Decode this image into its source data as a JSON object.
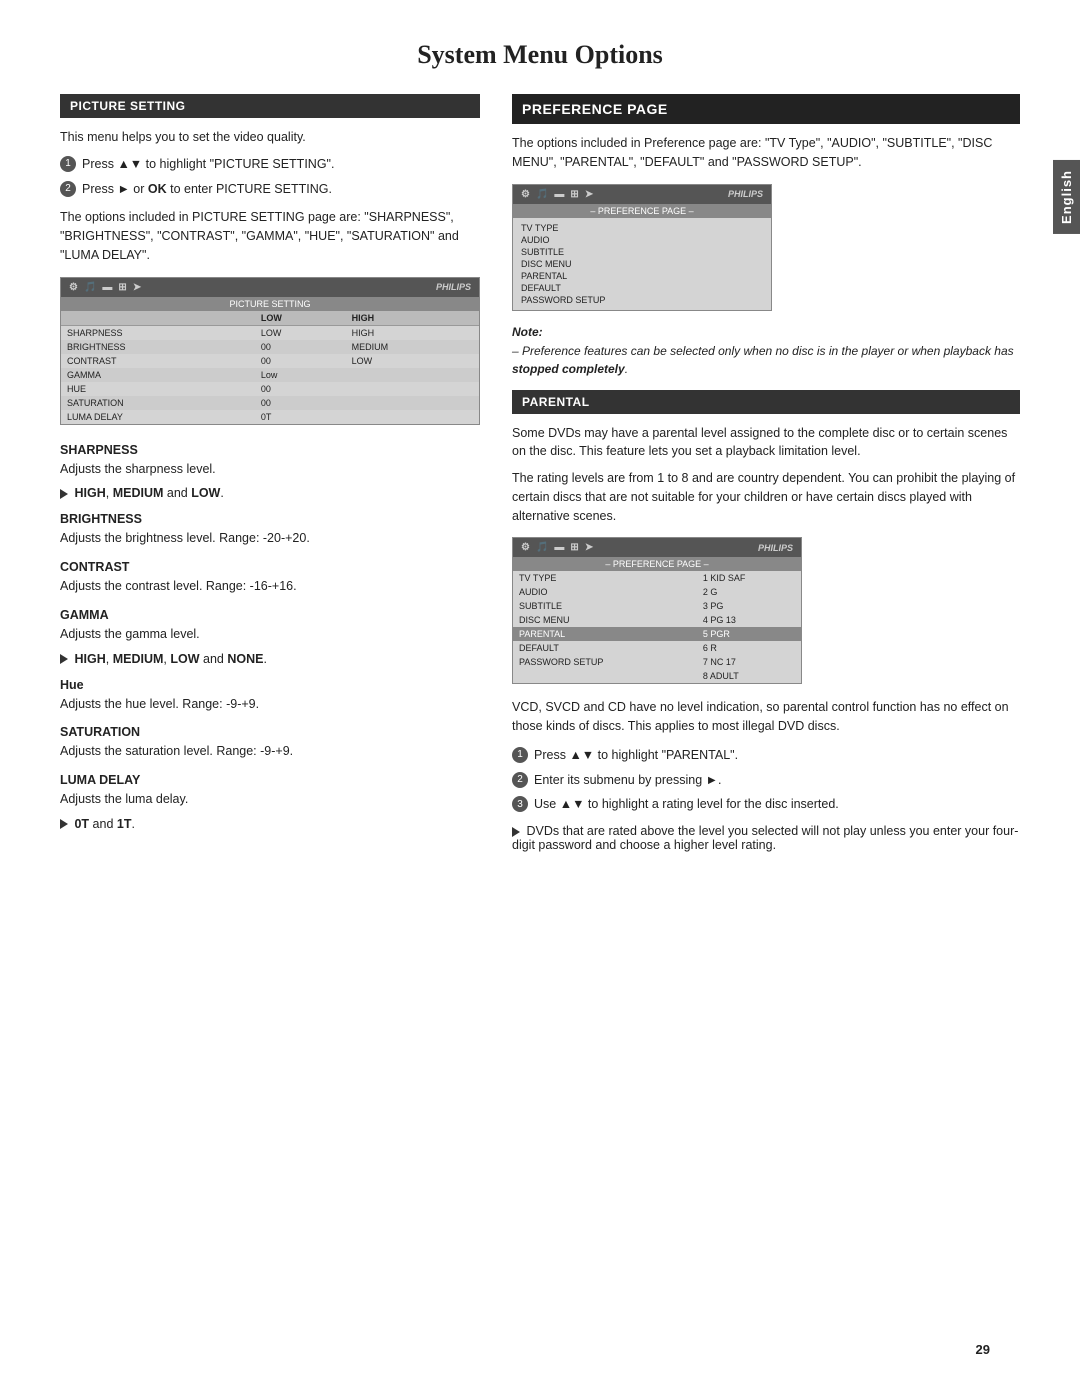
{
  "page": {
    "title": "System Menu Options",
    "page_number": "29"
  },
  "english_tab": "English",
  "picture_setting": {
    "header": "PICTURE SETTING",
    "intro": "This menu helps you to set the video quality.",
    "steps": [
      "Press ▲▼ to highlight \"PICTURE SETTING\".",
      "Press ► or OK to enter PICTURE SETTING."
    ],
    "body_text": "The options included in PICTURE SETTING page are: \"SHARPNESS\", \"BRIGHTNESS\", \"CONTRAST\", \"GAMMA\", \"HUE\", \"SATURATION\" and \"LUMA DELAY\".",
    "table": {
      "label": "PICTURE SETTING",
      "philips": "PHILIPS",
      "columns": [
        "",
        "LOW",
        "HIGH"
      ],
      "rows": [
        [
          "SHARPNESS",
          "LOW",
          "HIGH"
        ],
        [
          "BRIGHTNESS",
          "00",
          "MEDIUM"
        ],
        [
          "CONTRAST",
          "00",
          "LOW"
        ],
        [
          "GAMMA",
          "Low",
          ""
        ],
        [
          "HUE",
          "00",
          ""
        ],
        [
          "SATURATION",
          "00",
          ""
        ],
        [
          "LUMA DELAY",
          "0T",
          ""
        ]
      ]
    }
  },
  "sharpness": {
    "title": "SHARPNESS",
    "desc": "Adjusts the sharpness level.",
    "options": "HIGH, MEDIUM and LOW."
  },
  "brightness": {
    "title": "BRIGHTNESS",
    "desc": "Adjusts the brightness level. Range: -20-+20."
  },
  "contrast": {
    "title": "CONTRAST",
    "desc": "Adjusts the contrast level. Range: -16-+16."
  },
  "gamma": {
    "title": "GAMMA",
    "desc": "Adjusts the gamma level.",
    "options": "HIGH, MEDIUM, LOW and NONE."
  },
  "hue": {
    "title": "Hue",
    "desc": "Adjusts the hue level. Range: -9-+9."
  },
  "saturation": {
    "title": "SATURATION",
    "desc": "Adjusts the saturation level. Range: -9-+9."
  },
  "luma_delay": {
    "title": "LUMA DELAY",
    "desc": "Adjusts the luma delay.",
    "options": "0T and 1T."
  },
  "preference_page": {
    "header": "PREFERENCE PAGE",
    "intro": "The options included in Preference page are: \"TV Type\", \"AUDIO\", \"SUBTITLE\", \"DISC MENU\", \"PARENTAL\", \"DEFAULT\" and \"PASSWORD SETUP\".",
    "table": {
      "label": "– PREFERENCE PAGE –",
      "philips": "PHILIPS",
      "items": [
        "TV TYPE",
        "AUDIO",
        "SUBTITLE",
        "DISC MENU",
        "PARENTAL",
        "DEFAULT",
        "PASSWORD SETUP"
      ]
    },
    "note_title": "Note:",
    "note": "– Preference features can be selected only when no disc is in the player or when playback has stopped completely."
  },
  "parental": {
    "header": "PARENTAL",
    "para1": "Some DVDs may have a parental level assigned to the complete disc or to certain scenes on the disc. This feature lets you set a playback limitation level.",
    "para2": "The rating levels are from 1 to 8 and are country dependent. You can prohibit the playing of certain discs that are not suitable for your children or have certain discs played with alternative scenes.",
    "table": {
      "label": "– PREFERENCE PAGE –",
      "philips": "PHILIPS",
      "rows": [
        [
          "TV TYPE",
          ""
        ],
        [
          "AUDIO",
          ""
        ],
        [
          "SUBTITLE",
          ""
        ],
        [
          "DISC MENU",
          "4 PG 13"
        ],
        [
          "PARENTAL",
          "5 PGR"
        ],
        [
          "DEFAULT",
          "6 R"
        ],
        [
          "PASSWORD SETUP",
          "7 NC 17"
        ],
        [
          "",
          "8 ADULT"
        ]
      ],
      "highlighted_row": 4,
      "right_values": [
        "1 KID SAF",
        "2 G",
        "3 PG",
        "4 PG 13",
        "5 PGR",
        "6 R",
        "7 NC 17",
        "8 ADULT"
      ]
    },
    "vcd_note": "VCD, SVCD and CD have no level indication, so parental control function has no effect on those kinds of discs. This applies to most illegal DVD discs.",
    "steps": [
      "Press ▲▼ to highlight \"PARENTAL\".",
      "Enter its submenu by pressing ►.",
      "Use ▲▼ to highlight a rating level for the disc inserted."
    ],
    "arrow_note": "DVDs that are rated above the level you selected will not play unless you enter your four-digit password and choose a higher level rating."
  }
}
